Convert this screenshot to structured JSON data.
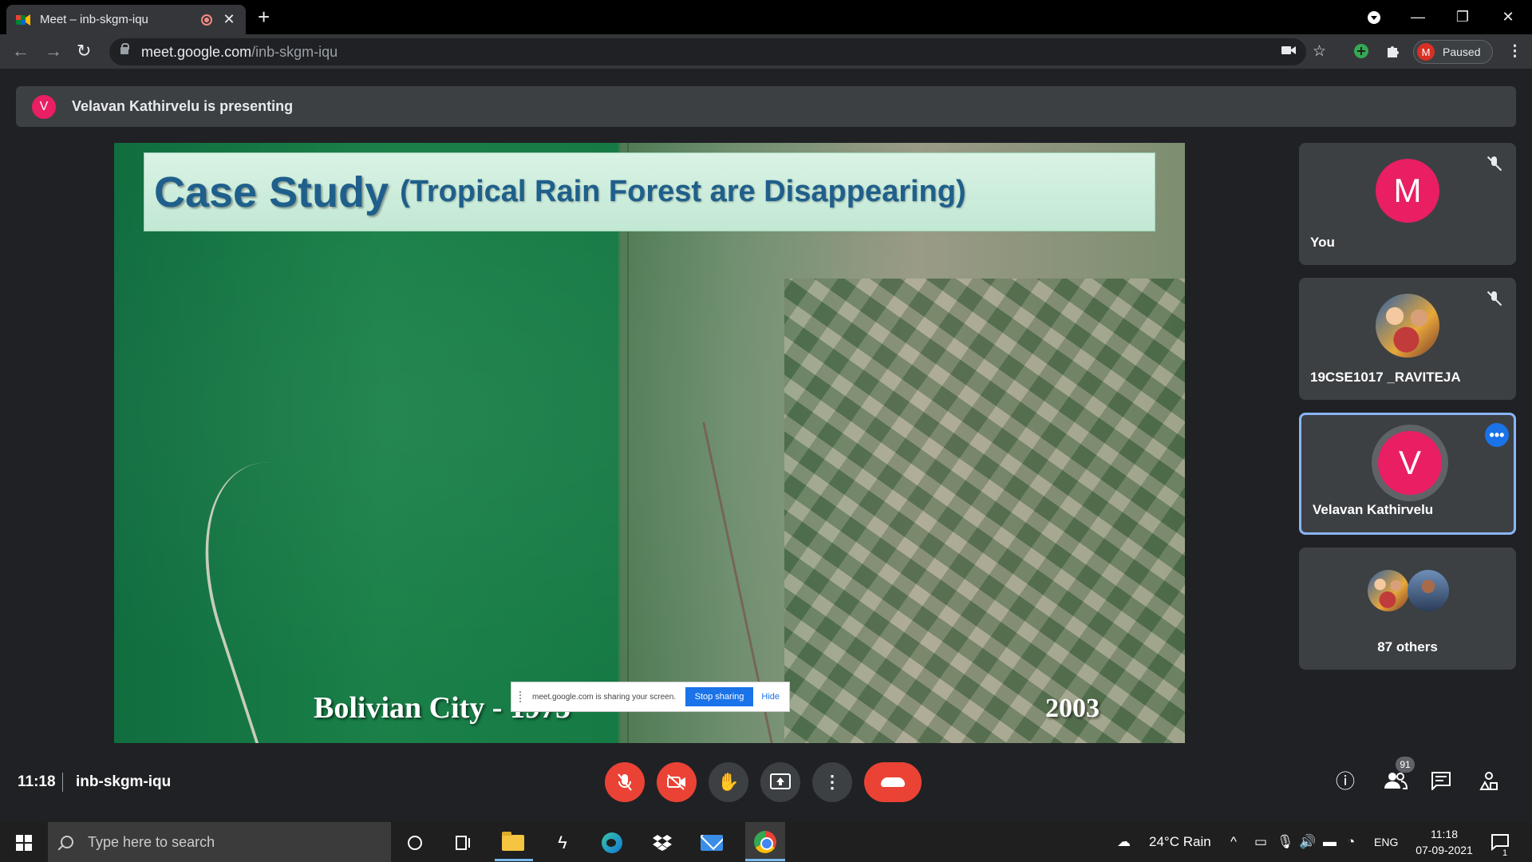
{
  "browser": {
    "tab_title": "Meet – inb-skgm-iqu",
    "tab_close": "✕",
    "new_tab": "+",
    "url_host": "meet.google.com",
    "url_path": "/inb-skgm-iqu",
    "profile_initial": "M",
    "profile_status": "Paused",
    "window_controls": [
      "—",
      "❐",
      "✕"
    ]
  },
  "presenting_banner": {
    "avatar_initial": "V",
    "text": "Velavan Kathirvelu is presenting",
    "avatar_color": "#e91e63"
  },
  "slide": {
    "title_main": "Case Study",
    "title_sub": "(Tropical Rain Forest are Disappearing)",
    "caption_left": "Bolivian City - 1975",
    "caption_right": "2003",
    "share_notice": {
      "message": "meet.google.com is sharing your screen.",
      "stop_label": "Stop sharing",
      "hide_label": "Hide"
    }
  },
  "participants": [
    {
      "name": "You",
      "initial": "M",
      "muted": true,
      "avatar_color": "#e91e63"
    },
    {
      "name": "19CSE1017 _RAVITEJA",
      "muted": true,
      "photo": true
    },
    {
      "name": "Velavan Kathirvelu",
      "initial": "V",
      "speaking": true,
      "avatar_color": "#e91e63"
    },
    {
      "name": "87 others"
    }
  ],
  "meeting_bar": {
    "time": "11:18",
    "meeting_code": "inb-skgm-iqu",
    "participant_count": "91",
    "accent_end": "#ea4335"
  },
  "taskbar": {
    "search_placeholder": "Type here to search",
    "weather": "24°C Rain",
    "language": "ENG",
    "clock_time": "11:18",
    "clock_date": "07-09-2021",
    "notification_count": "1"
  }
}
